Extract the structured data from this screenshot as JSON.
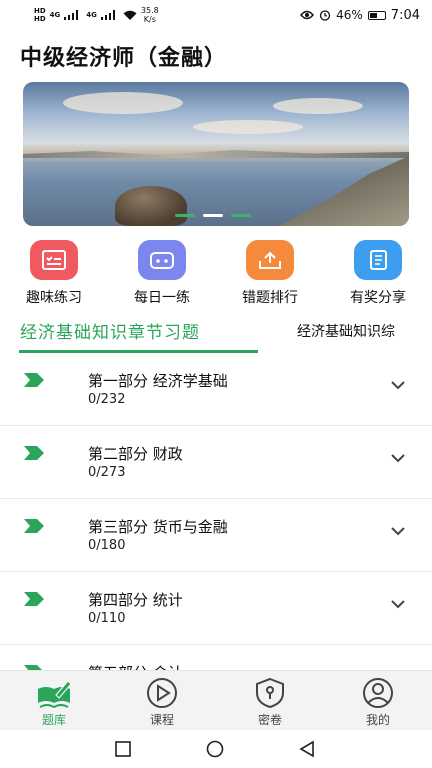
{
  "status_bar": {
    "hd1": "HD",
    "hd2": "HD",
    "net1": "4G",
    "net2": "4G",
    "speed_value": "35.8",
    "speed_unit": "K/s",
    "battery": "46%",
    "time": "7:04"
  },
  "page": {
    "title": "中级经济师（金融）"
  },
  "banner": {
    "slide_count": 3,
    "active_index": 1
  },
  "quick_actions": [
    {
      "label": "趣味练习",
      "icon": "list-check-icon",
      "color": "#f0595e"
    },
    {
      "label": "每日一练",
      "icon": "practice-card-icon",
      "color": "#7b86ee"
    },
    {
      "label": "错题排行",
      "icon": "tray-upload-icon",
      "color": "#f58a3c"
    },
    {
      "label": "有奖分享",
      "icon": "notebook-icon",
      "color": "#3d9ef0"
    }
  ],
  "tabs": [
    {
      "label": "经济基础知识章节习题",
      "active": true
    },
    {
      "label": "经济基础知识综",
      "active": false
    }
  ],
  "chapters": [
    {
      "title": "第一部分  经济学基础",
      "count": "0/232"
    },
    {
      "title": "第二部分  财政",
      "count": "0/273"
    },
    {
      "title": "第三部分  货币与金融",
      "count": "0/180"
    },
    {
      "title": "第四部分  统计",
      "count": "0/110"
    },
    {
      "title": "第五部分  会计",
      "count": ""
    }
  ],
  "bottom_nav": [
    {
      "label": "题库",
      "icon": "book-pen-icon",
      "active": true
    },
    {
      "label": "课程",
      "icon": "play-circle-icon",
      "active": false
    },
    {
      "label": "密卷",
      "icon": "shield-lock-icon",
      "active": false
    },
    {
      "label": "我的",
      "icon": "user-circle-icon",
      "active": false
    }
  ],
  "colors": {
    "accent": "#2aa55a"
  }
}
